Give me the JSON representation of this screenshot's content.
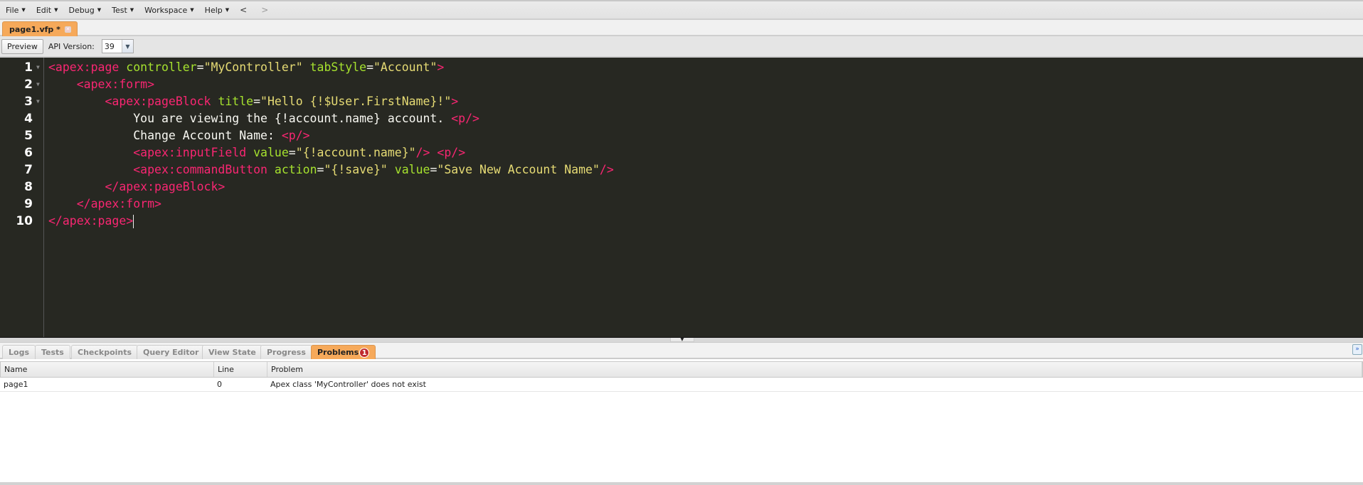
{
  "menu": {
    "items": [
      {
        "label": "File"
      },
      {
        "label": "Edit"
      },
      {
        "label": "Debug"
      },
      {
        "label": "Test"
      },
      {
        "label": "Workspace"
      },
      {
        "label": "Help"
      }
    ],
    "back": "<",
    "forward": ">"
  },
  "file_tab": {
    "label": "page1.vfp *",
    "close_icon": "close-icon"
  },
  "toolbar": {
    "preview_label": "Preview",
    "api_label": "API Version:",
    "api_value": "39"
  },
  "editor": {
    "lines": [
      {
        "n": "1",
        "fold": true
      },
      {
        "n": "2",
        "fold": true
      },
      {
        "n": "3",
        "fold": true
      },
      {
        "n": "4",
        "fold": false
      },
      {
        "n": "5",
        "fold": false
      },
      {
        "n": "6",
        "fold": false
      },
      {
        "n": "7",
        "fold": false
      },
      {
        "n": "8",
        "fold": false
      },
      {
        "n": "9",
        "fold": false
      },
      {
        "n": "10",
        "fold": false
      }
    ],
    "tokens": [
      [
        [
          "t",
          "<apex:page"
        ],
        [
          "p",
          " "
        ],
        [
          "a",
          "controller"
        ],
        [
          "p",
          "="
        ],
        [
          "s",
          "\"MyController\""
        ],
        [
          "p",
          " "
        ],
        [
          "a",
          "tabStyle"
        ],
        [
          "p",
          "="
        ],
        [
          "s",
          "\"Account\""
        ],
        [
          "t",
          ">"
        ]
      ],
      [
        [
          "p",
          "    "
        ],
        [
          "t",
          "<apex:form>"
        ]
      ],
      [
        [
          "p",
          "        "
        ],
        [
          "t",
          "<apex:pageBlock"
        ],
        [
          "p",
          " "
        ],
        [
          "a",
          "title"
        ],
        [
          "p",
          "="
        ],
        [
          "s",
          "\"Hello {!$User.FirstName}!\""
        ],
        [
          "t",
          ">"
        ]
      ],
      [
        [
          "p",
          "            You are viewing the {!account.name} account. "
        ],
        [
          "t",
          "<p/>"
        ]
      ],
      [
        [
          "p",
          "            Change Account Name: "
        ],
        [
          "t",
          "<p/>"
        ]
      ],
      [
        [
          "p",
          "            "
        ],
        [
          "t",
          "<apex:inputField"
        ],
        [
          "p",
          " "
        ],
        [
          "a",
          "value"
        ],
        [
          "p",
          "="
        ],
        [
          "s",
          "\"{!account.name}\""
        ],
        [
          "t",
          "/>"
        ],
        [
          "p",
          " "
        ],
        [
          "t",
          "<p/>"
        ]
      ],
      [
        [
          "p",
          "            "
        ],
        [
          "t",
          "<apex:commandButton"
        ],
        [
          "p",
          " "
        ],
        [
          "a",
          "action"
        ],
        [
          "p",
          "="
        ],
        [
          "s",
          "\"{!save}\""
        ],
        [
          "p",
          " "
        ],
        [
          "a",
          "value"
        ],
        [
          "p",
          "="
        ],
        [
          "s",
          "\"Save New Account Name\""
        ],
        [
          "t",
          "/>"
        ]
      ],
      [
        [
          "p",
          "        "
        ],
        [
          "t",
          "</apex:pageBlock>"
        ]
      ],
      [
        [
          "p",
          "    "
        ],
        [
          "t",
          "</apex:form>"
        ]
      ],
      [
        [
          "t",
          "</apex:page>"
        ]
      ]
    ]
  },
  "bottom_tabs": [
    {
      "label": "Logs"
    },
    {
      "label": "Tests"
    },
    {
      "label": "Checkpoints"
    },
    {
      "label": "Query Editor"
    },
    {
      "label": "View State"
    },
    {
      "label": "Progress"
    },
    {
      "label": "Problems",
      "badge": "1",
      "active": true
    }
  ],
  "problems": {
    "columns": [
      "Name",
      "Line",
      "Problem"
    ],
    "rows": [
      {
        "name": "page1",
        "line": "0",
        "problem": "Apex class 'MyController' does not exist"
      }
    ]
  },
  "colors": {
    "accent_tab": "#f6a95a",
    "editor_bg": "#272822",
    "tag": "#f92672",
    "attr": "#a6e22e",
    "string": "#e6db74",
    "badge": "#c0292d"
  }
}
